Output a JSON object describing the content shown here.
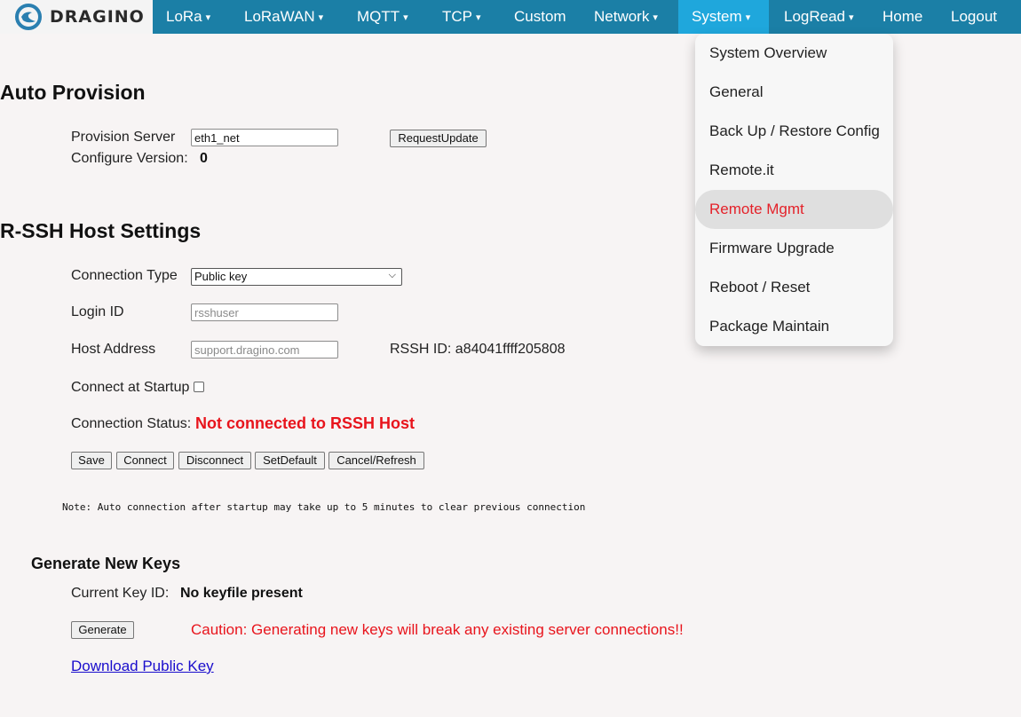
{
  "colors": {
    "nav_bg": "#1b7fa6",
    "nav_active": "#1fa7dc",
    "alert_red": "#e8141c",
    "link_blue": "#1a0dcc"
  },
  "brand": {
    "name": "DRAGINO",
    "icon": "dragino-logo-icon"
  },
  "nav": {
    "lora": "LoRa",
    "lorawan": "LoRaWAN",
    "mqtt": "MQTT",
    "tcp": "TCP",
    "custom": "Custom",
    "network": "Network",
    "system": "System",
    "logread": "LogRead",
    "home": "Home",
    "logout": "Logout",
    "caret": "▾"
  },
  "system_menu": [
    "System Overview",
    "General",
    "Back Up / Restore Config",
    "Remote.it",
    "Remote Mgmt",
    "Firmware Upgrade",
    "Reboot / Reset",
    "Package Maintain"
  ],
  "auto_provision": {
    "title": "Auto Provision",
    "server_label": "Provision Server",
    "server_value": "eth1_net",
    "request_button": "RequestUpdate",
    "version_label": "Configure Version:",
    "version_value": "0"
  },
  "rssh": {
    "title": "R-SSH Host Settings",
    "connection_type_label": "Connection Type",
    "connection_type_value": "Public key",
    "login_label": "Login ID",
    "login_placeholder": "rsshuser",
    "host_label": "Host Address",
    "host_placeholder": "support.dragino.com",
    "rssh_id": "RSSH ID: a84041ffff205808",
    "startup_label": "Connect at Startup",
    "startup_checked": false,
    "status_label": "Connection Status:",
    "status_value": "Not connected to RSSH Host",
    "buttons": {
      "save": "Save",
      "connect": "Connect",
      "disconnect": "Disconnect",
      "setdefault": "SetDefault",
      "cancel": "Cancel/Refresh"
    },
    "note": "Note: Auto connection after startup may take up to 5 minutes to clear previous connection"
  },
  "keys": {
    "title": "Generate New Keys",
    "current_label": "Current Key ID:",
    "current_value": "No keyfile present",
    "generate_button": "Generate",
    "caution": "Caution: Generating new keys will break any existing server connections!!",
    "download_link": "Download Public Key"
  }
}
